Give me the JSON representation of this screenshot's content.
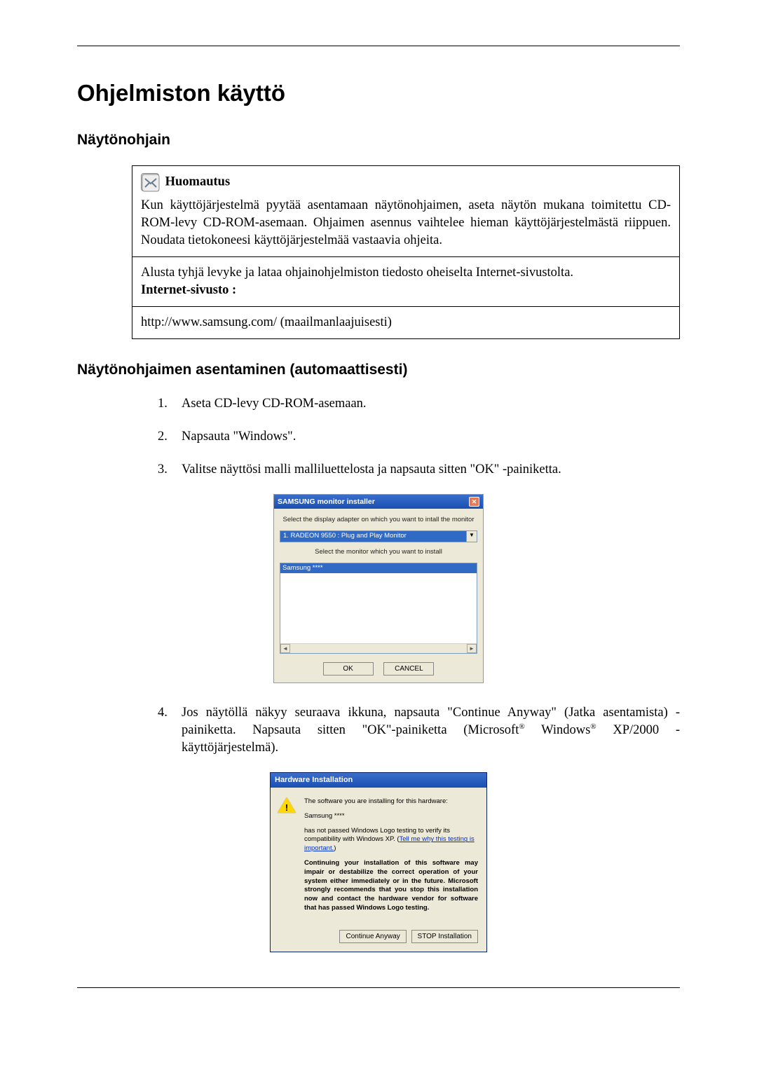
{
  "page": {
    "title": "Ohjelmiston käyttö",
    "section1_title": "Näytönohjain",
    "note": {
      "label": "Huomautus",
      "para1": "Kun käyttöjärjestelmä pyytää asentamaan näytönohjaimen, aseta näytön mukana toimitettu CD-ROM-levy CD-ROM-asemaan. Ohjaimen asennus vaihtelee hieman käyttöjärjestelmästä riippuen. Noudata tietokoneesi käyttöjärjestelmää vastaavia ohjeita.",
      "para2a": "Alusta tyhjä levyke ja lataa ohjainohjelmiston tiedosto oheiselta Internet-sivustolta.",
      "para2b_label": "Internet-sivusto :",
      "para3": "http://www.samsung.com/ (maailmanlaajuisesti)"
    },
    "section2_title": "Näytönohjaimen asentaminen (automaattisesti)",
    "steps": {
      "s1": "Aseta CD-levy CD-ROM-asemaan.",
      "s2": "Napsauta \"Windows\".",
      "s3": "Valitse näyttösi malli malliluettelosta ja napsauta sitten \"OK\" -painiketta.",
      "s4a": "Jos näytöllä näkyy seuraava ikkuna, napsauta \"Continue Anyway\" (Jatka asentamista) -painiketta. Napsauta sitten \"OK\"-painiketta (Microsoft",
      "s4b": " Windows",
      "s4c": " XP/2000 -käyttöjärjestelmä)."
    }
  },
  "samsung_installer": {
    "title": "SAMSUNG monitor installer",
    "label1": "Select the display adapter on which you want to intall the monitor",
    "combo_value": "1. RADEON 9550 : Plug and Play Monitor",
    "label2": "Select the monitor which you want to install",
    "list_selected": "Samsung ****",
    "btn_ok": "OK",
    "btn_cancel": "CANCEL"
  },
  "hw_install": {
    "title": "Hardware Installation",
    "p1": "The software you are installing for this hardware:",
    "p2": "Samsung ****",
    "p3a": "has not passed Windows Logo testing to verify its compatibility with Windows XP. (",
    "p3_link": "Tell me why this testing is important.",
    "p3b": ")",
    "p4": "Continuing your installation of this software may impair or destabilize the correct operation of your system either immediately or in the future. Microsoft strongly recommends that you stop this installation now and contact the hardware vendor for software that has passed Windows Logo testing.",
    "btn_continue": "Continue Anyway",
    "btn_stop": "STOP Installation"
  }
}
